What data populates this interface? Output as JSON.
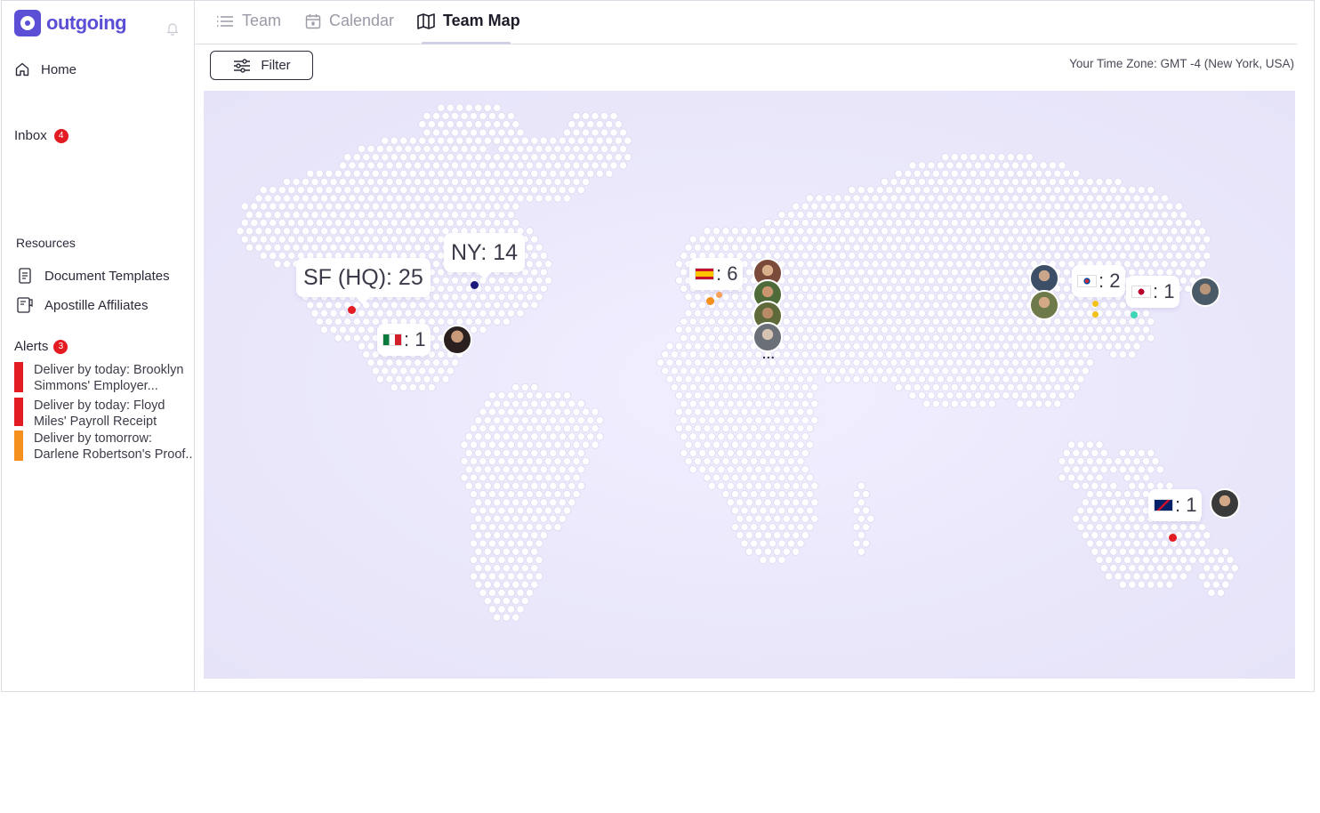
{
  "app": {
    "brand": "outgoing"
  },
  "sidebar": {
    "home_label": "Home",
    "inbox_label": "Inbox",
    "inbox_count": "4",
    "resources_title": "Resources",
    "resources": [
      {
        "label": "Document Templates",
        "icon": "document-icon"
      },
      {
        "label": "Apostille Affiliates",
        "icon": "certificate-icon"
      }
    ],
    "alerts_title": "Alerts",
    "alerts_count": "3",
    "alerts": [
      {
        "line1": "Deliver by today: Brooklyn",
        "line2": "Simmons' Employer...",
        "color": "#e31b23"
      },
      {
        "line1": "Deliver by today: Floyd",
        "line2": "Miles' Payroll Receipt",
        "color": "#e31b23"
      },
      {
        "line1": "Deliver by tomorrow:",
        "line2": "Darlene Robertson's Proof...",
        "color": "#f5901f"
      }
    ]
  },
  "tabs": [
    {
      "label": "Team",
      "icon": "list-icon",
      "active": false
    },
    {
      "label": "Calendar",
      "icon": "calendar-icon",
      "active": false
    },
    {
      "label": "Team Map",
      "icon": "map-icon",
      "active": true
    }
  ],
  "toolbar": {
    "filter_label": "Filter",
    "timezone": "Your Time Zone: GMT -4 (New York, USA)"
  },
  "map": {
    "locations": [
      {
        "label": "SF (HQ): 25",
        "dot_color": "#e31b23"
      },
      {
        "label": "NY: 14",
        "dot_color": "#1a1a7a"
      },
      {
        "flag": "mexico-flag",
        "count": ": 1",
        "dot_color": ""
      },
      {
        "flag": "spain-flag",
        "count": ": 6",
        "dot_color": "#f5901f"
      },
      {
        "flag": "south-korea-flag",
        "count": ": 2",
        "dot_color": "#f2c21b"
      },
      {
        "flag": "japan-flag",
        "count": ": 1",
        "dot_color": "#3fd6b8"
      },
      {
        "flag": "australia-flag",
        "count": ": 1",
        "dot_color": "#e31b23"
      }
    ],
    "more_label": "..."
  }
}
